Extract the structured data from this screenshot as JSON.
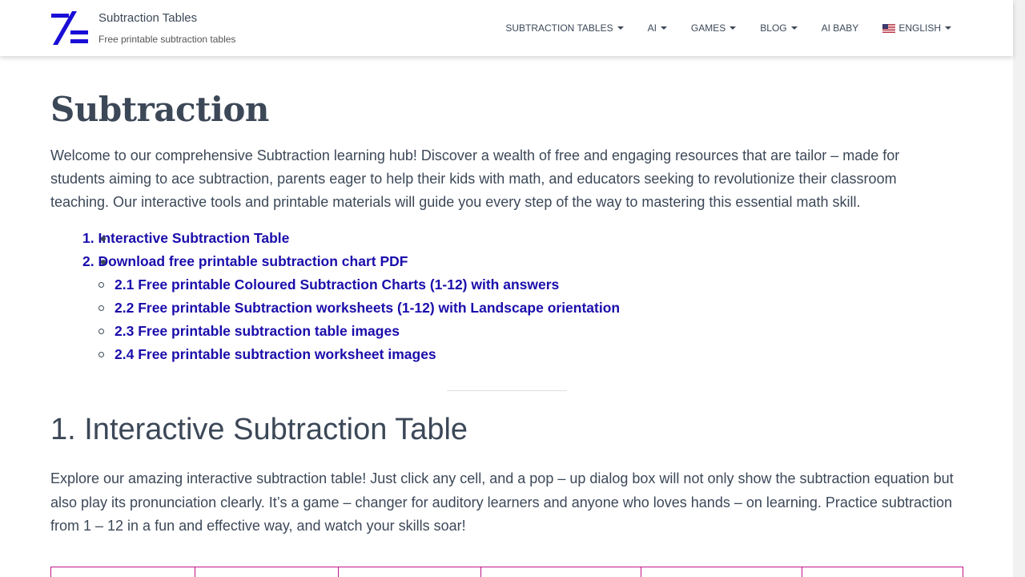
{
  "header": {
    "site_title": "Subtraction Tables",
    "site_description": "Free printable subtraction tables",
    "nav": [
      {
        "label": "SUBTRACTION TABLES",
        "dropdown": true
      },
      {
        "label": "AI",
        "dropdown": true
      },
      {
        "label": "GAMES",
        "dropdown": true
      },
      {
        "label": "BLOG",
        "dropdown": true
      },
      {
        "label": "AI BABY",
        "dropdown": false
      },
      {
        "label": "ENGLISH",
        "dropdown": true,
        "icon": "us-flag-icon"
      }
    ]
  },
  "main": {
    "title": "Subtraction",
    "intro": "Welcome to our comprehensive Subtraction learning hub! Discover a wealth of free and engaging resources that are tailor – made for students aiming to ace subtraction, parents eager to help their kids with math, and educators seeking to revolutionize their classroom teaching. Our interactive tools and printable materials will guide you every step of the way to mastering this essential math skill.",
    "toc": {
      "item1": "1. Interactive Subtraction Table",
      "item2": "2. Download free printable subtraction chart PDF",
      "sub": [
        "2.1 Free printable Coloured Subtraction Charts (1-12) with answers",
        "2.2 Free printable Subtraction worksheets (1-12) with Landscape orientation",
        "2.3 Free printable subtraction table images",
        "2.4 Free printable subtraction worksheet images"
      ]
    },
    "section1": {
      "title": "1. Interactive Subtraction Table",
      "body": "Explore our amazing interactive subtraction table! Just click any cell, and a pop – up dialog box will not only show the subtraction equation but also play its pronunciation clearly. It’s a game – changer for auditory learners and anyone who loves hands – on learning. Practice subtraction from 1 – 12 in a fun and effective way, and watch your skills soar!"
    }
  },
  "colors": {
    "link": "#1a0dab",
    "text": "#3c4858",
    "logo": "#1a0dd6",
    "table_border": "#c0168b"
  }
}
